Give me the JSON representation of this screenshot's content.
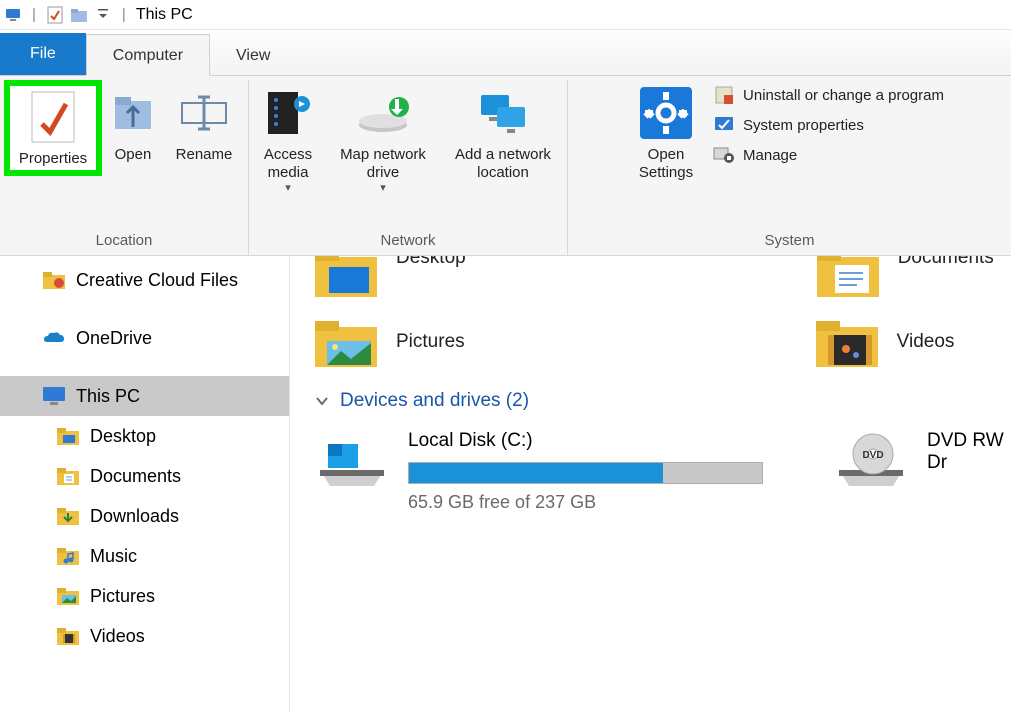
{
  "window": {
    "title": "This PC"
  },
  "tabs": {
    "file": "File",
    "computer": "Computer",
    "view": "View"
  },
  "ribbon": {
    "location": {
      "label": "Location",
      "properties": "Properties",
      "open": "Open",
      "rename": "Rename"
    },
    "network": {
      "label": "Network",
      "access_media": "Access media",
      "map_drive": "Map network drive",
      "add_location": "Add a network location"
    },
    "system": {
      "label": "System",
      "open_settings": "Open Settings",
      "uninstall": "Uninstall or change a program",
      "sysprops": "System properties",
      "manage": "Manage"
    }
  },
  "sidebar": {
    "creative_cloud": "Creative Cloud Files",
    "onedrive": "OneDrive",
    "this_pc": "This PC",
    "desktop": "Desktop",
    "documents": "Documents",
    "downloads": "Downloads",
    "music": "Music",
    "pictures": "Pictures",
    "videos": "Videos"
  },
  "main": {
    "folders": {
      "desktop": "Desktop",
      "documents": "Documents",
      "pictures": "Pictures",
      "videos": "Videos"
    },
    "devices_header": "Devices and drives (2)",
    "local_disk": {
      "label": "Local Disk (C:)",
      "free_text": "65.9 GB free of 237 GB",
      "used_percent": 72
    },
    "dvd": {
      "label": "DVD RW Dr"
    }
  }
}
